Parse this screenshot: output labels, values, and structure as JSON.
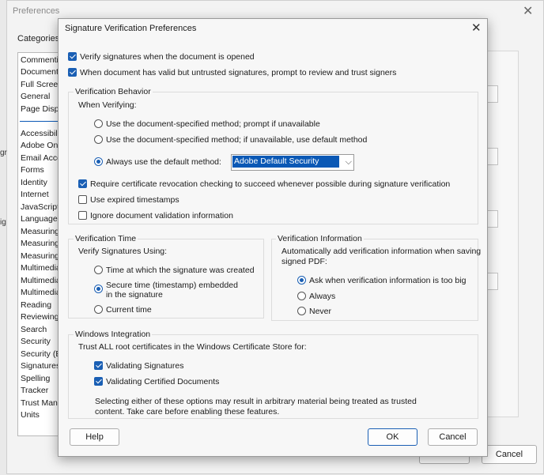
{
  "background_window": {
    "title": "Preferences",
    "categories_label": "Categories:",
    "categories": [
      "Commenting",
      "Documents",
      "Full Screen",
      "General",
      "Page Display",
      "Accessibility",
      "Adobe Online",
      "Email Accounts",
      "Forms",
      "Identity",
      "Internet",
      "JavaScript",
      "Language",
      "Measuring",
      "Measuring",
      "Measuring",
      "Multimedia",
      "Multimedia",
      "Multimedia",
      "Reading",
      "Reviewing",
      "Search",
      "Security",
      "Security (E",
      "Signatures",
      "Spelling",
      "Tracker",
      "Trust Mana",
      "Units"
    ],
    "cancel_label": "Cancel",
    "left_fragments": [
      "gr",
      "ig"
    ]
  },
  "dialog": {
    "title": "Signature Verification Preferences",
    "verify_on_open": {
      "label": "Verify signatures when the document is opened",
      "checked": true
    },
    "prompt_untrusted": {
      "label": "When document has valid but untrusted signatures, prompt to review and trust signers",
      "checked": true
    },
    "behavior": {
      "title": "Verification Behavior",
      "when_verifying": "When Verifying:",
      "options": [
        {
          "label": "Use the document-specified method; prompt if unavailable",
          "selected": false
        },
        {
          "label": "Use the document-specified method; if unavailable, use default method",
          "selected": false
        },
        {
          "label": "Always use the default method:",
          "selected": true
        }
      ],
      "default_method": "Adobe Default Security",
      "require_revocation": {
        "label": "Require certificate revocation checking to succeed whenever possible during signature verification",
        "checked": true
      },
      "use_expired": {
        "label": "Use expired timestamps",
        "checked": false
      },
      "ignore_validation": {
        "label": "Ignore document validation information",
        "checked": false
      }
    },
    "time": {
      "title": "Verification Time",
      "subtitle": "Verify Signatures Using:",
      "options": [
        {
          "label": "Time at which the signature was created",
          "selected": false
        },
        {
          "label_line1": "Secure time (timestamp) embedded",
          "label_line2": "in the signature",
          "selected": true
        },
        {
          "label": "Current time",
          "selected": false
        }
      ]
    },
    "info": {
      "title": "Verification Information",
      "desc_line1": "Automatically add verification information when saving",
      "desc_line2": "signed PDF:",
      "options": [
        {
          "label": "Ask when verification information is too big",
          "selected": true
        },
        {
          "label": "Always",
          "selected": false
        },
        {
          "label": "Never",
          "selected": false
        }
      ]
    },
    "windows": {
      "title": "Windows Integration",
      "subtitle": "Trust ALL root certificates in the Windows Certificate Store for:",
      "validating_signatures": {
        "label": "Validating Signatures",
        "checked": true
      },
      "validating_certified": {
        "label": "Validating Certified Documents",
        "checked": true
      },
      "warning_line1": "Selecting either of these options may result in arbitrary material being treated as trusted",
      "warning_line2": "content. Take care before enabling these features."
    },
    "help_label": "Help",
    "ok_label": "OK",
    "cancel_label": "Cancel"
  }
}
